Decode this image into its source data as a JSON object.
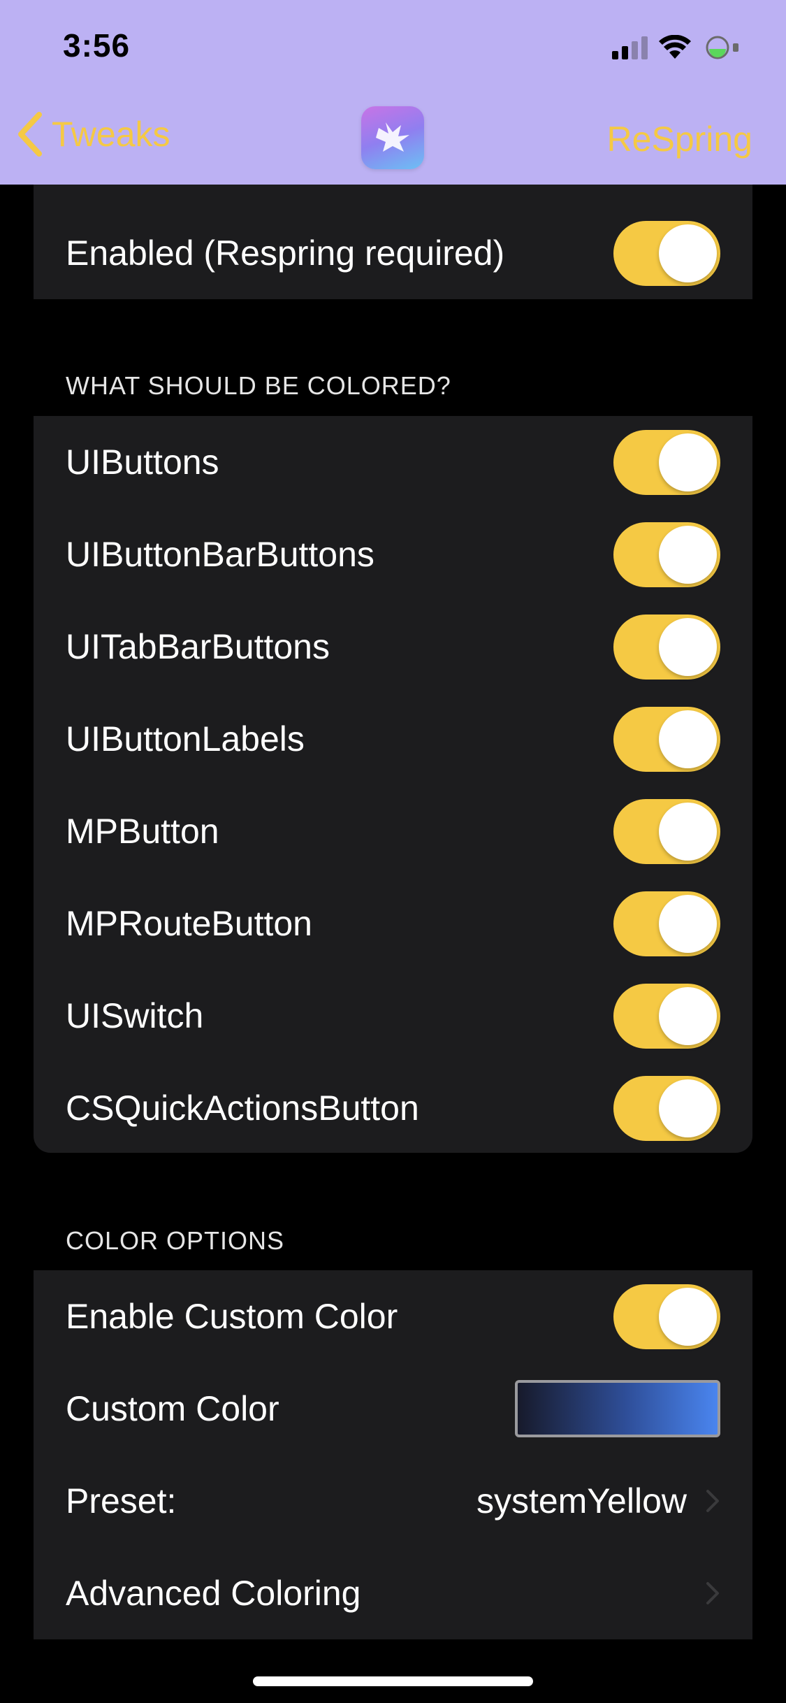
{
  "status_bar": {
    "time": "3:56"
  },
  "nav": {
    "back_label": "Tweaks",
    "action_label": "ReSpring",
    "accent_color": "#f5c944",
    "background_color": "#bcb1f3"
  },
  "enabled_row": {
    "label": "Enabled (Respring required)",
    "on": true
  },
  "colored_section": {
    "header": "WHAT SHOULD BE COLORED?",
    "items": [
      {
        "label": "UIButtons",
        "on": true
      },
      {
        "label": "UIButtonBarButtons",
        "on": true
      },
      {
        "label": "UITabBarButtons",
        "on": true
      },
      {
        "label": "UIButtonLabels",
        "on": true
      },
      {
        "label": "MPButton",
        "on": true
      },
      {
        "label": "MPRouteButton",
        "on": true
      },
      {
        "label": "UISwitch",
        "on": true
      },
      {
        "label": "CSQuickActionsButton",
        "on": true
      }
    ]
  },
  "color_options": {
    "header": "COLOR OPTIONS",
    "enable_custom_color": {
      "label": "Enable Custom Color",
      "on": true
    },
    "custom_color": {
      "label": "Custom Color",
      "swatch_start": "#171a2b",
      "swatch_end": "#4a85ef"
    },
    "preset": {
      "label": "Preset:",
      "value": "systemYellow"
    },
    "advanced": {
      "label": "Advanced Coloring"
    }
  },
  "icons": [
    "signal-icon",
    "wifi-icon",
    "battery-icon",
    "chevron-left-icon",
    "app-logo-icon",
    "chevron-right-icon"
  ]
}
